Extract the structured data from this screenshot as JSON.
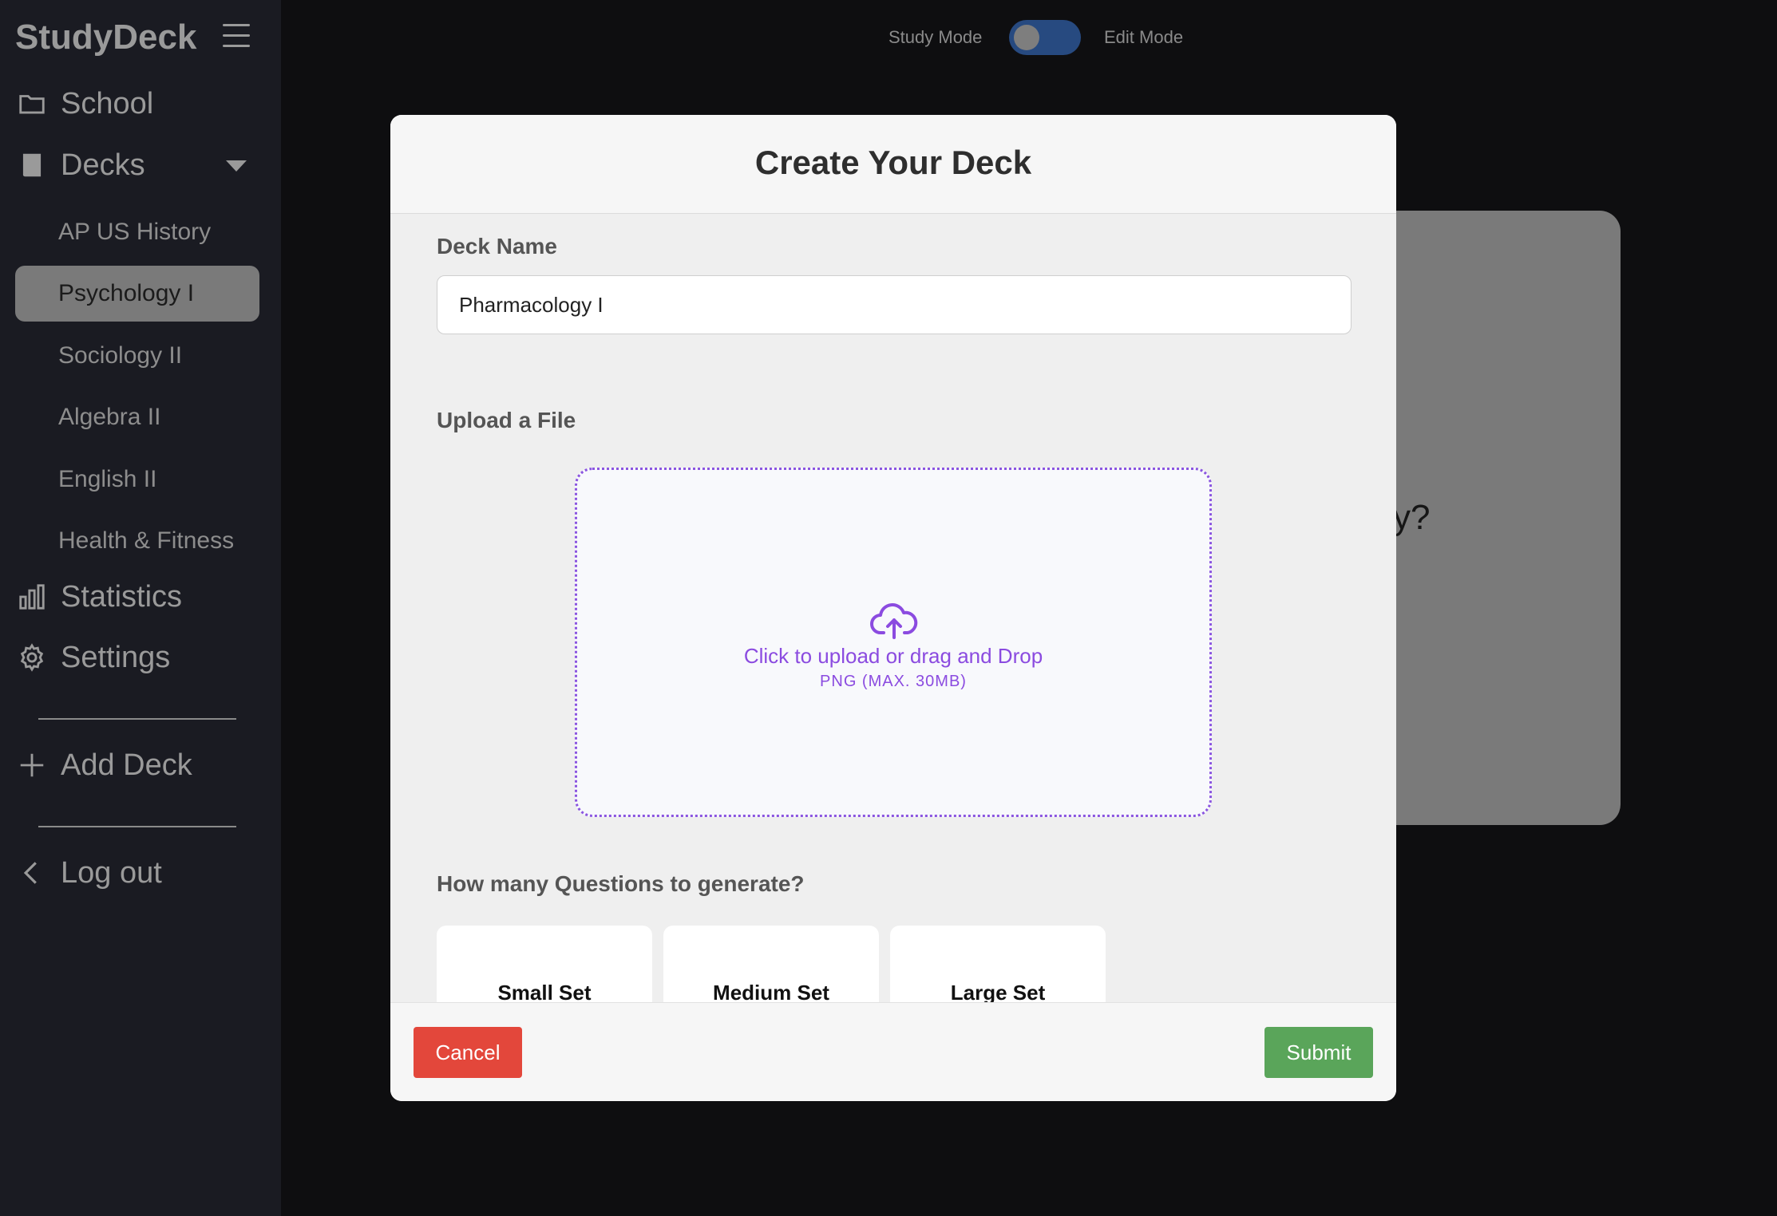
{
  "sidebar": {
    "brand": "StudyDeck",
    "nav": {
      "school": "School",
      "decks": "Decks",
      "statistics": "Statistics",
      "settings": "Settings",
      "add_deck": "Add Deck",
      "log_out": "Log out"
    },
    "decks": [
      "AP US History",
      "Psychology I",
      "Sociology II",
      "Algebra II",
      "English II",
      "Health & Fitness"
    ],
    "active_deck": "Psychology I"
  },
  "topbar": {
    "study_mode": "Study Mode",
    "edit_mode": "Edit Mode",
    "toggle_state": "study"
  },
  "background": {
    "card_text_fragment": "y?"
  },
  "modal": {
    "title": "Create Your Deck",
    "deck_name_label": "Deck Name",
    "deck_name_value": "Pharmacology I",
    "upload_label": "Upload a File",
    "upload_text": "Click to upload or drag and Drop",
    "upload_hint": "PNG (MAX. 30MB)",
    "questions_label": "How many Questions to generate?",
    "sets": [
      "Small Set",
      "Medium Set",
      "Large Set"
    ],
    "cancel": "Cancel",
    "submit": "Submit"
  },
  "colors": {
    "accent_purple": "#8b4be0",
    "cancel_red": "#e3473b",
    "submit_green": "#5aa55a",
    "toggle_blue": "#274a80"
  }
}
